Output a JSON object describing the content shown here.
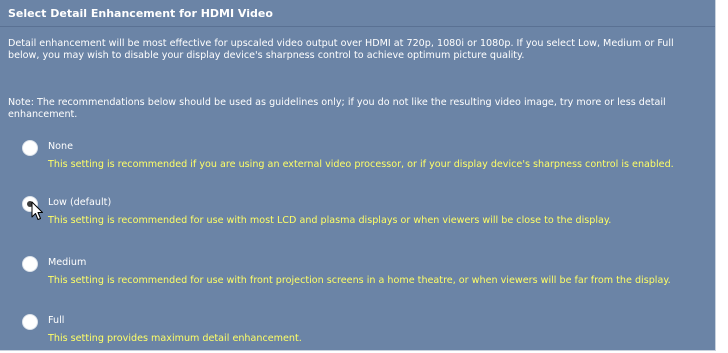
{
  "panel": {
    "title": "Select Detail Enhancement for HDMI Video",
    "intro": "Detail enhancement will be most effective for upscaled video output over HDMI at 720p, 1080i or 1080p. If you select Low, Medium or Full below, you may wish to disable your display device's sharpness control to achieve optimum picture quality.",
    "note": "Note: The recommendations below should be used as guidelines only; if you do not like the resulting video image, try more or less detail enhancement."
  },
  "options": [
    {
      "label": "None",
      "description": "This setting is recommended if you are using an external video processor, or if your display device's sharpness control is enabled.",
      "selected": false
    },
    {
      "label": "Low (default)",
      "description": "This setting is recommended for use with most LCD and plasma displays or when viewers will be close to the display.",
      "selected": true
    },
    {
      "label": "Medium",
      "description": "This setting is recommended for use with front projection screens in a home theatre, or when viewers will be far from the display.",
      "selected": false
    },
    {
      "label": "Full",
      "description": "This setting provides maximum detail enhancement.",
      "selected": false
    }
  ],
  "colors": {
    "panel_background": "#6b84a6",
    "label_text": "#ffffff",
    "description_text": "#ffff66"
  },
  "icons": {
    "pointer": "mouse-pointer-icon"
  }
}
